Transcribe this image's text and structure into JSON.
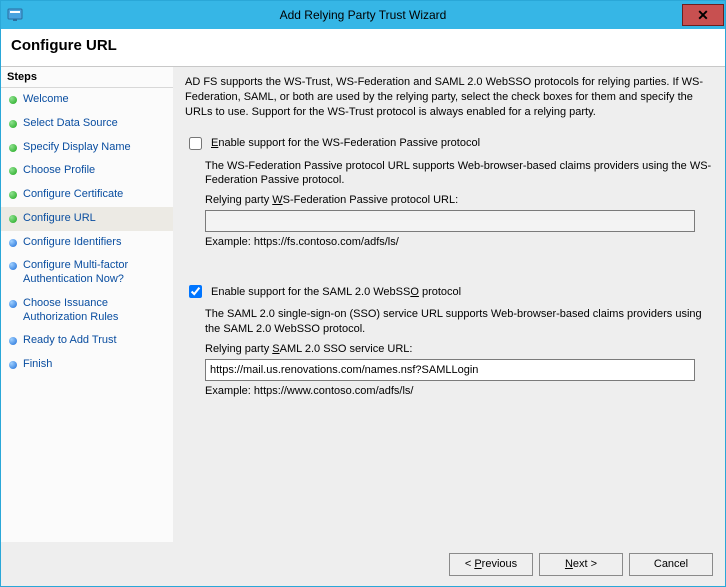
{
  "window": {
    "title": "Add Relying Party Trust Wizard"
  },
  "header": {
    "title": "Configure URL"
  },
  "sidebar": {
    "steps_title": "Steps",
    "steps": [
      {
        "label": "Welcome",
        "state": "done"
      },
      {
        "label": "Select Data Source",
        "state": "done"
      },
      {
        "label": "Specify Display Name",
        "state": "done"
      },
      {
        "label": "Choose Profile",
        "state": "done"
      },
      {
        "label": "Configure Certificate",
        "state": "done"
      },
      {
        "label": "Configure URL",
        "state": "current"
      },
      {
        "label": "Configure Identifiers",
        "state": "pending"
      },
      {
        "label": "Configure Multi-factor Authentication Now?",
        "state": "pending"
      },
      {
        "label": "Choose Issuance Authorization Rules",
        "state": "pending"
      },
      {
        "label": "Ready to Add Trust",
        "state": "pending"
      },
      {
        "label": "Finish",
        "state": "pending"
      }
    ]
  },
  "content": {
    "intro": "AD FS supports the WS-Trust, WS-Federation and SAML 2.0 WebSSO protocols for relying parties.  If WS-Federation, SAML, or both are used by the relying party, select the check boxes for them and specify the URLs to use.  Support for the WS-Trust protocol is always enabled for a relying party.",
    "wsfed": {
      "checkbox_label_pre": "",
      "checkbox_label_accel": "E",
      "checkbox_label_post": "nable support for the WS-Federation Passive protocol",
      "checked": false,
      "desc": "The WS-Federation Passive protocol URL supports Web-browser-based claims providers using the WS-Federation Passive protocol.",
      "url_label_pre": "Relying party ",
      "url_label_accel": "W",
      "url_label_post": "S-Federation Passive protocol URL:",
      "url_value": "",
      "example": "Example: https://fs.contoso.com/adfs/ls/"
    },
    "saml": {
      "checkbox_label_pre": "Enable support for the SAML 2.0 WebSS",
      "checkbox_label_accel": "O",
      "checkbox_label_post": " protocol",
      "checked": true,
      "desc": "The SAML 2.0 single-sign-on (SSO) service URL supports Web-browser-based claims providers using the SAML 2.0 WebSSO protocol.",
      "url_label_pre": "Relying party ",
      "url_label_accel": "S",
      "url_label_post": "AML 2.0 SSO service URL:",
      "url_value": "https://mail.us.renovations.com/names.nsf?SAMLLogin",
      "example": "Example: https://www.contoso.com/adfs/ls/"
    }
  },
  "footer": {
    "previous_pre": "< ",
    "previous_accel": "P",
    "previous_post": "revious",
    "next_pre": "",
    "next_accel": "N",
    "next_post": "ext >",
    "cancel": "Cancel"
  }
}
